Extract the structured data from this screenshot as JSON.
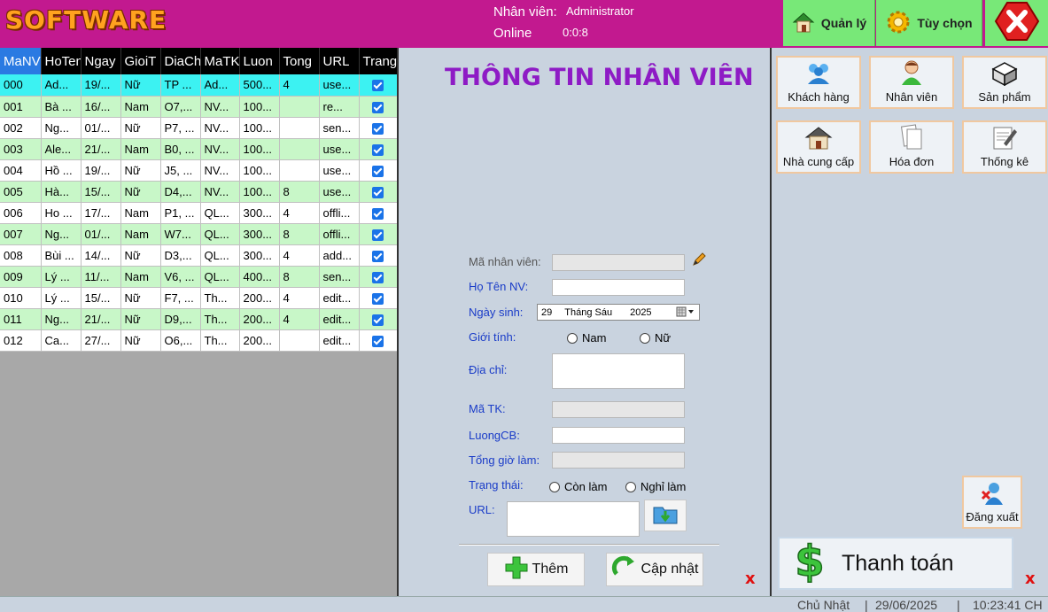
{
  "app": {
    "logo": "SOFTWARE"
  },
  "header": {
    "employee_label": "Nhân viên:",
    "employee_value": "Administrator",
    "online_label": "Online",
    "online_value": "0:0:8",
    "manage_button": "Quản lý",
    "options_button": "Tùy chọn"
  },
  "grid": {
    "columns": [
      "MaNV",
      "HoTen",
      "Ngay",
      "GioiT",
      "DiaCh",
      "MaTK",
      "Luon",
      "Tong",
      "URL",
      "Trang"
    ],
    "rows": [
      [
        "000",
        "Ad...",
        "19/...",
        "Nữ",
        "TP ...",
        "Ad...",
        "500...",
        "4",
        "use...",
        true
      ],
      [
        "001",
        "Bà ...",
        "16/...",
        "Nam",
        "O7,...",
        "NV...",
        "100...",
        "",
        "re...",
        true
      ],
      [
        "002",
        "Ng...",
        "01/...",
        "Nữ",
        "P7, ...",
        "NV...",
        "100...",
        "",
        "sen...",
        true
      ],
      [
        "003",
        "Ale...",
        "21/...",
        "Nam",
        "B0, ...",
        "NV...",
        "100...",
        "",
        "use...",
        true
      ],
      [
        "004",
        "Hồ ...",
        "19/...",
        "Nữ",
        "J5, ...",
        "NV...",
        "100...",
        "",
        "use...",
        true
      ],
      [
        "005",
        "Hà...",
        "15/...",
        "Nữ",
        "D4,...",
        "NV...",
        "100...",
        "8",
        "use...",
        true
      ],
      [
        "006",
        "Ho ...",
        "17/...",
        "Nam",
        "P1, ...",
        "QL...",
        "300...",
        "4",
        "offli...",
        true
      ],
      [
        "007",
        "Ng...",
        "01/...",
        "Nam",
        "W7...",
        "QL...",
        "300...",
        "8",
        "offli...",
        true
      ],
      [
        "008",
        "Bùi ...",
        "14/...",
        "Nữ",
        "D3,...",
        "QL...",
        "300...",
        "4",
        "add...",
        true
      ],
      [
        "009",
        "Lý ...",
        "11/...",
        "Nam",
        "V6, ...",
        "QL...",
        "400...",
        "8",
        "sen...",
        true
      ],
      [
        "010",
        "Lý ...",
        "15/...",
        "Nữ",
        "F7, ...",
        "Th...",
        "200...",
        "4",
        "edit...",
        true
      ],
      [
        "011",
        "Ng...",
        "21/...",
        "Nữ",
        "D9,...",
        "Th...",
        "200...",
        "4",
        "edit...",
        true
      ],
      [
        "012",
        "Ca...",
        "27/...",
        "Nữ",
        "O6,...",
        "Th...",
        "200...",
        "",
        "edit...",
        true
      ]
    ]
  },
  "form": {
    "title": "THÔNG TIN NHÂN VIÊN",
    "ma_nv_label": "Mã nhân viên:",
    "ho_ten_label": "Họ Tên NV:",
    "ngay_sinh_label": "Ngày sinh:",
    "date_day": "29",
    "date_month": "Tháng Sáu",
    "date_year": "2025",
    "gioi_tinh_label": "Giới tính:",
    "gender_male": "Nam",
    "gender_female": "Nữ",
    "dia_chi_label": "Địa chỉ:",
    "ma_tk_label": "Mã TK:",
    "luong_label": "LuongCB:",
    "tong_gio_label": "Tổng giờ làm:",
    "trang_thai_label": "Trạng thái:",
    "status_active": "Còn làm",
    "status_quit": "Nghỉ làm",
    "url_label": "URL:",
    "add_button": "Thêm",
    "update_button": "Cập nhật",
    "close_mark": "x"
  },
  "side": {
    "tiles": [
      "Khách hàng",
      "Nhân viên",
      "Sản phẩm",
      "Nhà cung cấp",
      "Hóa đơn",
      "Thống kê"
    ],
    "logout": "Đăng xuất",
    "pay": "Thanh toán",
    "close_mark": "x"
  },
  "status": {
    "day": "Chủ Nhật",
    "date": "29/06/2025",
    "time": "10:23:41 CH"
  },
  "colors": {
    "header": "#c2198f",
    "accent_green": "#78e878",
    "title_purple": "#8e1bc5",
    "label_blue": "#1a3cc8",
    "row_active": "#3cf2f2",
    "row_even": "#c8f7c8"
  }
}
